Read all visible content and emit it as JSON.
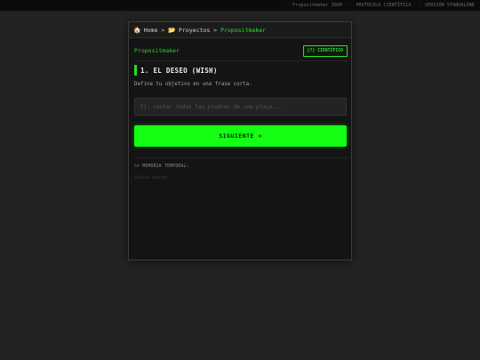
{
  "topbar": {
    "items": [
      "Propositmaker 3000",
      "PROTOCOLO CIENTÍFICO",
      "VERSIÓN STANDALONE"
    ],
    "separator": ":::"
  },
  "breadcrumb": {
    "home_icon": "home-icon",
    "home": "Home",
    "sep": ">",
    "folder_icon": "folder-icon",
    "projects": "Proyectos",
    "current": "Propositmaker"
  },
  "header": {
    "app_name": "Propositmaker",
    "mode_badge": "[?] CIENTÍFICO"
  },
  "step": {
    "title": "1. EL DESEO (WISH)",
    "description": "Define tu objetivo en una frase corta."
  },
  "wish_input": {
    "value": "",
    "placeholder": "Ej: contar todas las piedras de una playa..."
  },
  "next_button": {
    "label": "SIGUIENTE >"
  },
  "memory": {
    "label": ">> MEMORIA TEMPORAL:",
    "empty_text": "(Vacía ahora)"
  },
  "colors": {
    "accent": "#14ff14",
    "accent_text": "#2fd42f",
    "background": "#222222",
    "panel": "#141414"
  }
}
